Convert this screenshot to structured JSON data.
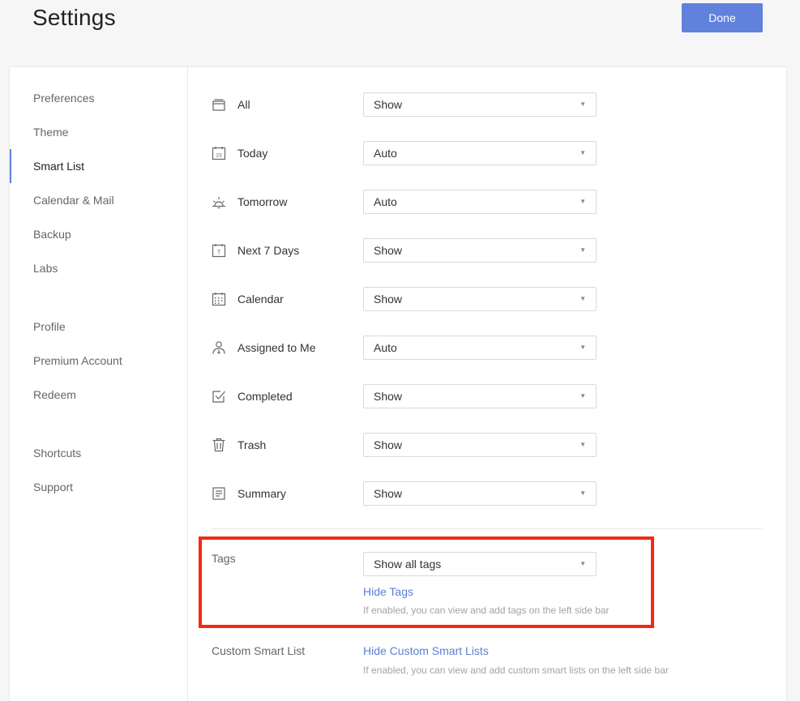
{
  "header": {
    "title": "Settings",
    "done_label": "Done"
  },
  "colors": {
    "accent": "#6182dc",
    "link": "#5b7fd6",
    "highlight": "#f22a14"
  },
  "sidebar": {
    "items": [
      {
        "label": "Preferences"
      },
      {
        "label": "Theme"
      },
      {
        "label": "Smart List",
        "active": true
      },
      {
        "label": "Calendar & Mail"
      },
      {
        "label": "Backup"
      },
      {
        "label": "Labs"
      },
      {
        "label": "Profile"
      },
      {
        "label": "Premium Account"
      },
      {
        "label": "Redeem"
      },
      {
        "label": "Shortcuts"
      },
      {
        "label": "Support"
      }
    ]
  },
  "smart_lists": [
    {
      "label": "All",
      "icon": "inbox-icon",
      "value": "Show"
    },
    {
      "label": "Today",
      "icon": "calendar-day-icon",
      "day": "23",
      "value": "Auto"
    },
    {
      "label": "Tomorrow",
      "icon": "sunrise-icon",
      "value": "Auto"
    },
    {
      "label": "Next 7 Days",
      "icon": "calendar-week-icon",
      "day": "T",
      "value": "Show"
    },
    {
      "label": "Calendar",
      "icon": "calendar-grid-icon",
      "value": "Show"
    },
    {
      "label": "Assigned to Me",
      "icon": "assigned-user-icon",
      "value": "Auto"
    },
    {
      "label": "Completed",
      "icon": "checkbox-icon",
      "value": "Show"
    },
    {
      "label": "Trash",
      "icon": "trash-icon",
      "value": "Show"
    },
    {
      "label": "Summary",
      "icon": "summary-icon",
      "value": "Show"
    }
  ],
  "tags": {
    "label": "Tags",
    "value": "Show all tags",
    "link": "Hide Tags",
    "help": "If enabled, you can view and add tags on the left side bar"
  },
  "custom_smart_list": {
    "label": "Custom Smart List",
    "link": "Hide Custom Smart Lists",
    "help": "If enabled, you can view and add custom smart lists on the left side bar"
  }
}
